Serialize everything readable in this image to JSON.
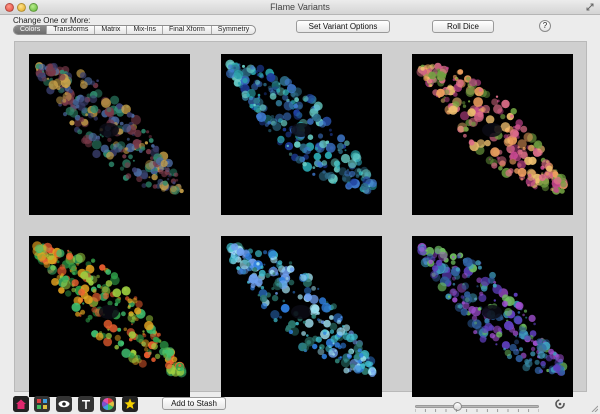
{
  "window": {
    "title": "Flame Variants"
  },
  "controls": {
    "change_label": "Change One or More:",
    "segments": [
      {
        "label": "Colors",
        "active": true
      },
      {
        "label": "Transforms",
        "active": false
      },
      {
        "label": "Matrix",
        "active": false
      },
      {
        "label": "Mix-Ins",
        "active": false
      },
      {
        "label": "Final Xform",
        "active": false
      },
      {
        "label": "Symmetry",
        "active": false
      }
    ],
    "set_variant_label": "Set Variant Options",
    "roll_dice_label": "Roll Dice",
    "help_label": "?"
  },
  "variants": [
    {
      "palette": [
        "#3a3f6e",
        "#7a3a4a",
        "#2f8a6e",
        "#c9a24a",
        "#4f6fa8"
      ]
    },
    {
      "palette": [
        "#1f3f9e",
        "#2aa8b0",
        "#3f7ad0",
        "#2e6e8a",
        "#6ad0c8"
      ]
    },
    {
      "palette": [
        "#e0708a",
        "#f0a060",
        "#c84890",
        "#70a040",
        "#f0c070"
      ]
    },
    {
      "palette": [
        "#2fa04a",
        "#e0a020",
        "#40c070",
        "#f06030",
        "#a0d040"
      ]
    },
    {
      "palette": [
        "#3080e0",
        "#40c0d0",
        "#70a0f0",
        "#2d7a70",
        "#a0e0f0"
      ]
    },
    {
      "palette": [
        "#6040c0",
        "#40a0c0",
        "#a050d0",
        "#3060a0",
        "#70c060"
      ]
    }
  ],
  "toolbar": {
    "tools": [
      {
        "icon": "home-icon",
        "color": "#e0286e"
      },
      {
        "icon": "grid-icon",
        "color": "#333333"
      },
      {
        "icon": "eye-icon",
        "color": "#333333"
      },
      {
        "icon": "text-icon",
        "color": "#333333"
      },
      {
        "icon": "color-wheel-icon",
        "color": "#333333"
      },
      {
        "icon": "star-icon",
        "color": "#222222"
      }
    ],
    "stash_label": "Add to Stash"
  },
  "slider": {
    "value": 0.34
  }
}
